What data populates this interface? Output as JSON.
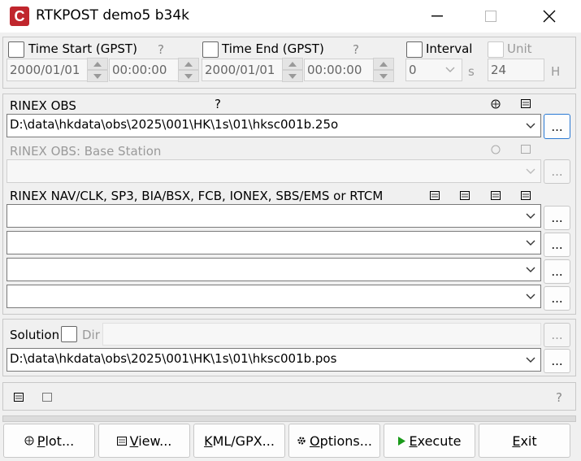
{
  "window": {
    "title": "RTKPOST demo5 b34k",
    "app_icon_letter": "C",
    "minimize_icon": "minimize-icon",
    "maximize_icon": "maximize-icon",
    "close_icon": "close-icon"
  },
  "time": {
    "start_label": "Time Start (GPST)",
    "start_help": "?",
    "start_date": "2000/01/01",
    "start_time": "00:00:00",
    "end_label": "Time End (GPST)",
    "end_help": "?",
    "end_date": "2000/01/01",
    "end_time": "00:00:00",
    "interval_label": "Interval",
    "interval_value": "0",
    "interval_unit": "s",
    "unit_label": "Unit",
    "unit_value": "24",
    "unit_suffix": "H"
  },
  "inputs": {
    "rinex_obs_label": "RINEX OBS",
    "rinex_obs_help": "?",
    "rinex_obs_value": "D:\\data\\hkdata\\obs\\2025\\001\\HK\\1s\\01\\hksc001b.25o",
    "base_label": "RINEX OBS: Base Station",
    "base_value": "",
    "nav_label": "RINEX NAV/CLK, SP3, BIA/BSX, FCB, IONEX, SBS/EMS  or RTCM",
    "nav_values": [
      "",
      "",
      "",
      ""
    ],
    "browse_label": "..."
  },
  "solution": {
    "label": "Solution",
    "dir_label": "Dir",
    "dir_value": "",
    "output_value": "D:\\data\\hkdata\\obs\\2025\\001\\HK\\1s\\01\\hksc001b.pos",
    "help": "?"
  },
  "buttons": {
    "plot_first": "P",
    "plot_rest": "lot...",
    "view_first": "V",
    "view_rest": "iew...",
    "kml_first": "K",
    "kml_rest": "ML/GPX...",
    "options_first": "O",
    "options_rest": "ptions...",
    "execute_first": "E",
    "execute_rest": "xecute",
    "exit_first": "E",
    "exit_rest": "xit"
  },
  "colors": {
    "accent": "#2a79d3",
    "app_icon": "#c0262d",
    "execute_icon": "#1a9a1a"
  }
}
